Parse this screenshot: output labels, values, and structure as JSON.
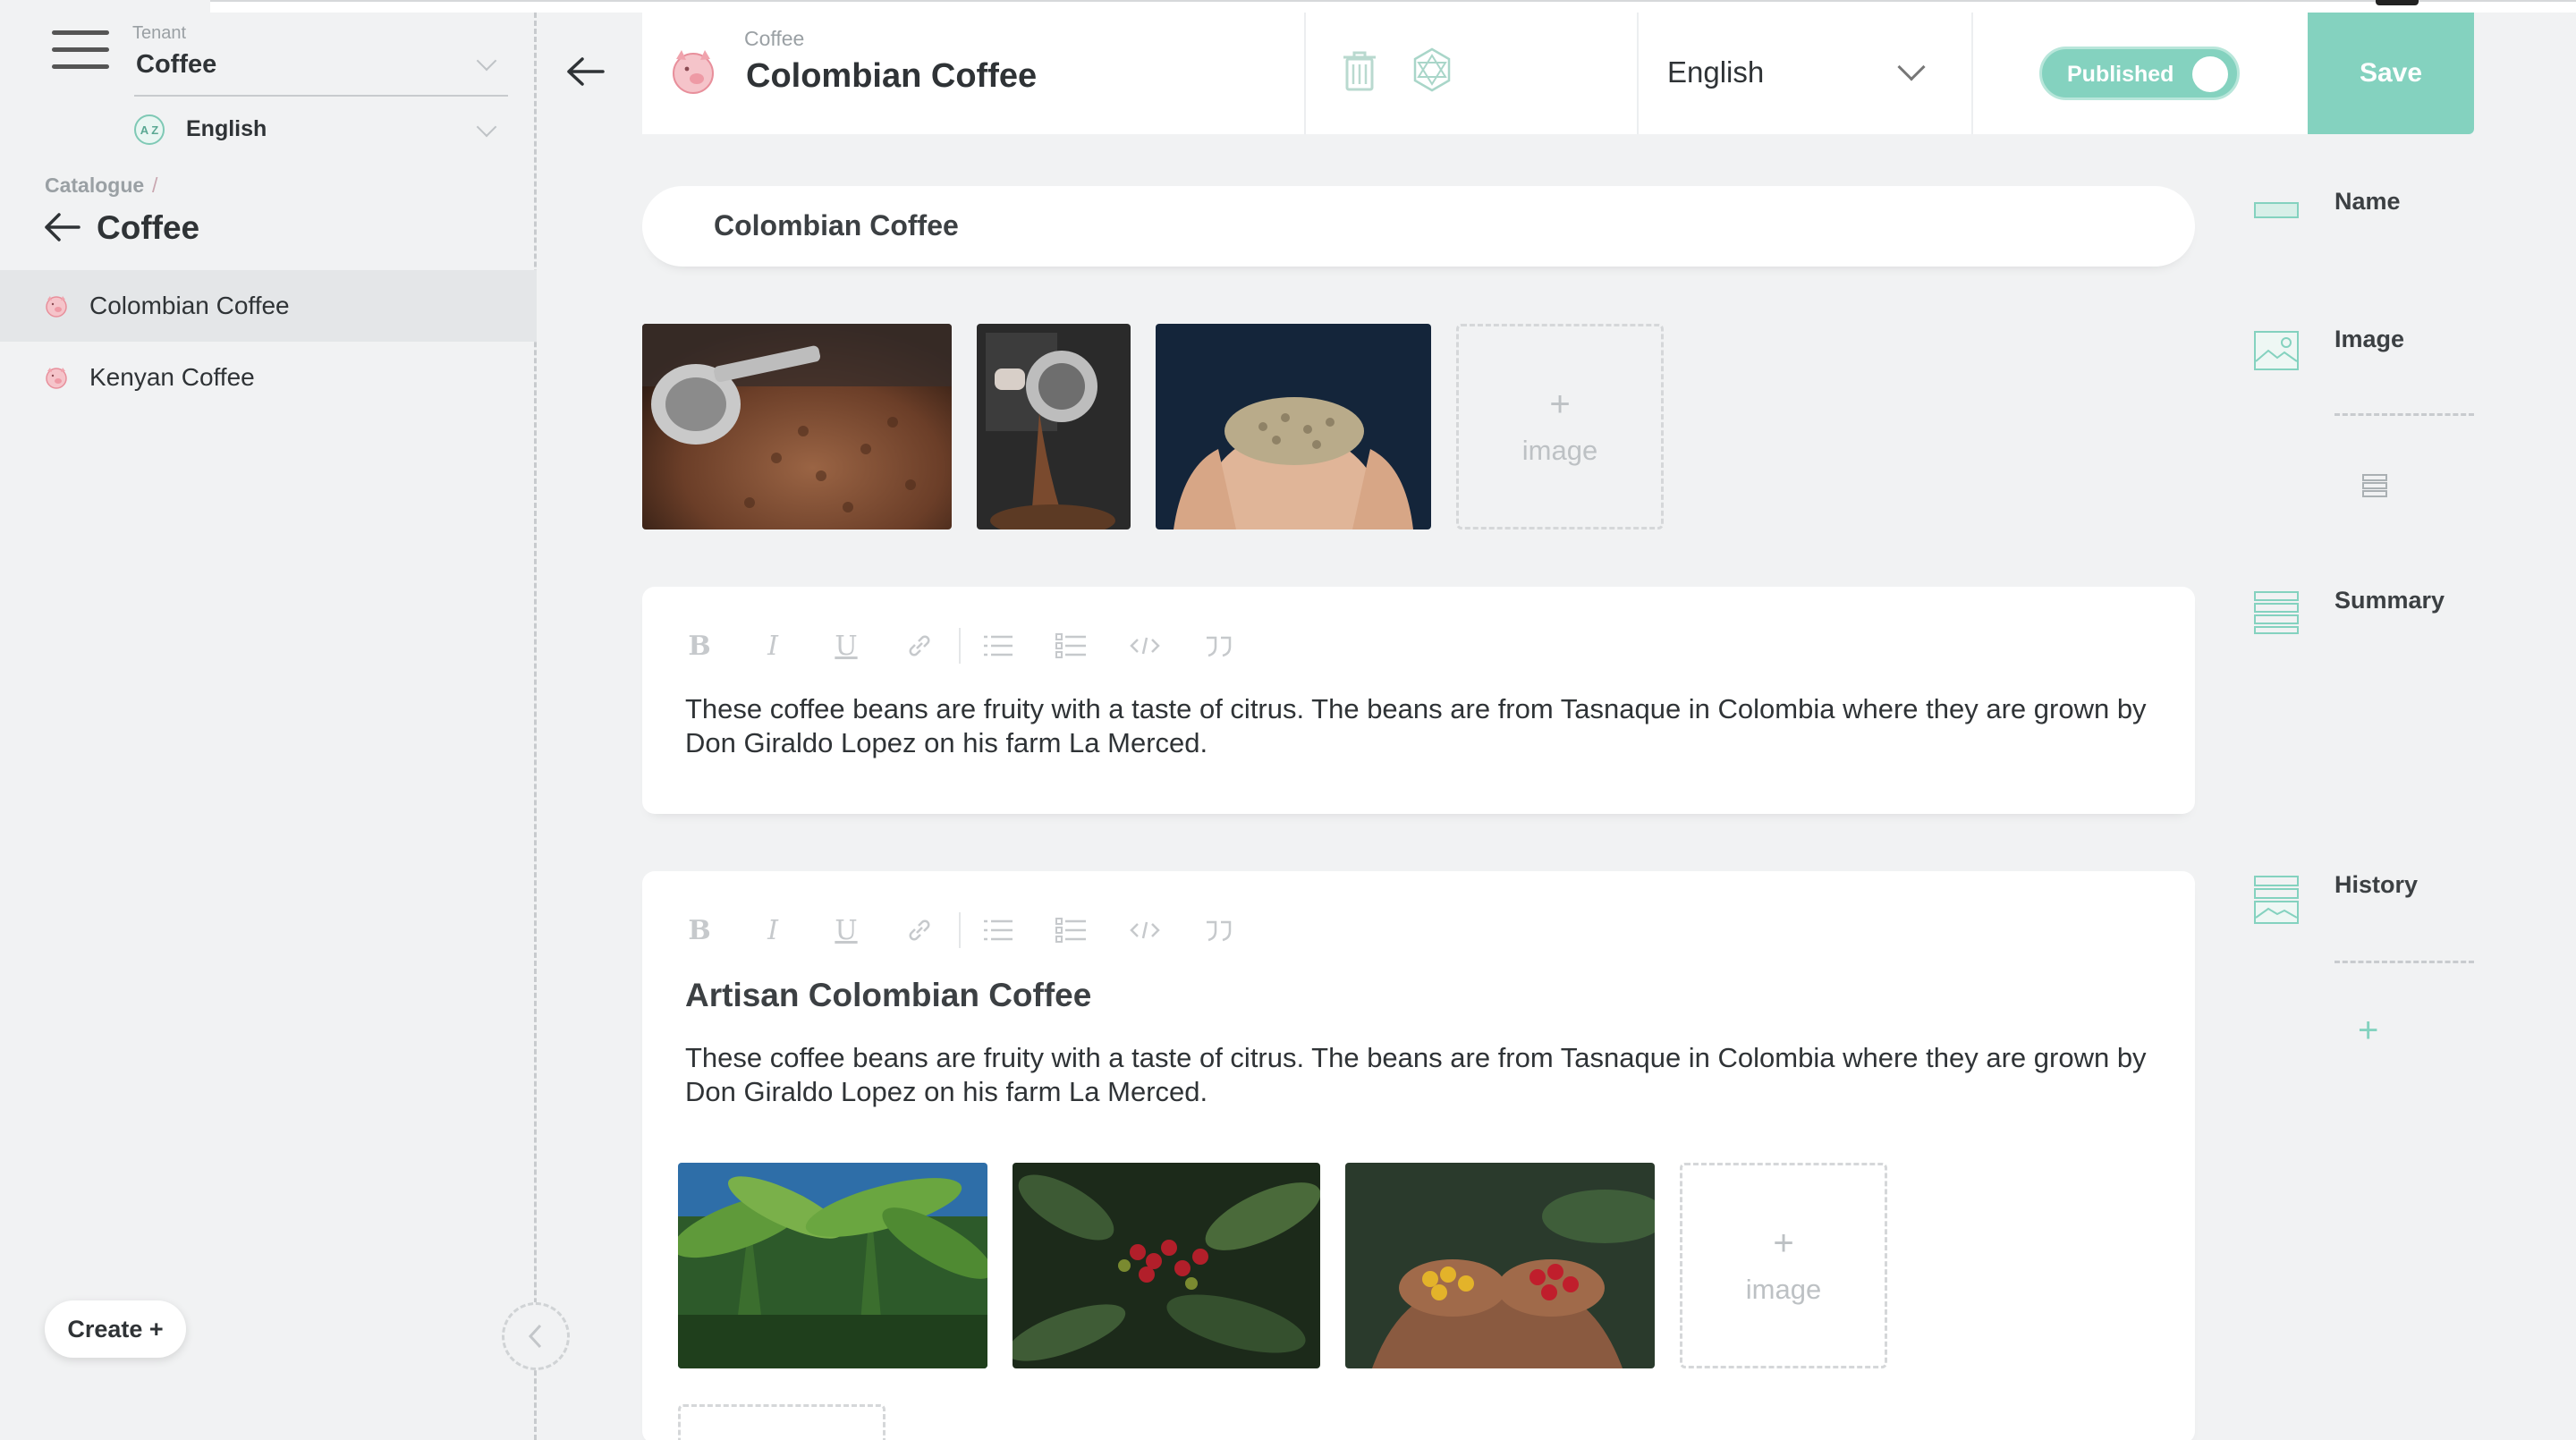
{
  "sidebar": {
    "tenant_label": "Tenant",
    "tenant_value": "Coffee",
    "language_icon_text": "A Z",
    "language_value": "English",
    "breadcrumb_parent": "Catalogue",
    "breadcrumb_sep": "/",
    "breadcrumb_title": "Coffee",
    "items": [
      {
        "label": "Colombian Coffee",
        "active": true,
        "icon": "pig-icon"
      },
      {
        "label": "Kenyan Coffee",
        "active": false,
        "icon": "pig-icon"
      }
    ],
    "create_label": "Create +"
  },
  "header": {
    "subtitle": "Coffee",
    "title": "Colombian Coffee",
    "language": "English",
    "published_label": "Published",
    "published": true,
    "save_label": "Save"
  },
  "content": {
    "name_value": "Colombian Coffee",
    "images": [
      {
        "name": "coffee-roaster-beans-image"
      },
      {
        "name": "coffee-roaster-machine-image"
      },
      {
        "name": "green-beans-hands-image"
      }
    ],
    "add_image_plus": "+",
    "add_image_label": "image",
    "summary_text": "These coffee beans are fruity with a taste of citrus. The beans are from Tasnaque in Colombia where they are grown by Don Giraldo Lopez on his farm La Merced.",
    "history_heading": "Artisan Colombian Coffee",
    "history_text": "These coffee beans are fruity with a taste of citrus. The beans are from Tasnaque in Colombia where they are grown by Don Giraldo Lopez on his farm La Merced.",
    "history_images": [
      {
        "name": "banana-plants-image"
      },
      {
        "name": "coffee-cherries-branch-image"
      },
      {
        "name": "coffee-cherries-hands-image"
      }
    ],
    "toolbar_buttons": [
      "bold",
      "italic",
      "underline",
      "link",
      "bullet-list",
      "numbered-list",
      "code",
      "quote"
    ]
  },
  "rail": {
    "name_label": "Name",
    "image_label": "Image",
    "summary_label": "Summary",
    "history_label": "History",
    "add_plus": "+"
  },
  "colors": {
    "accent": "#84d2bf",
    "accent_light": "#b8e6da",
    "background": "#f1f2f3",
    "pig": "#f2a7b0"
  }
}
